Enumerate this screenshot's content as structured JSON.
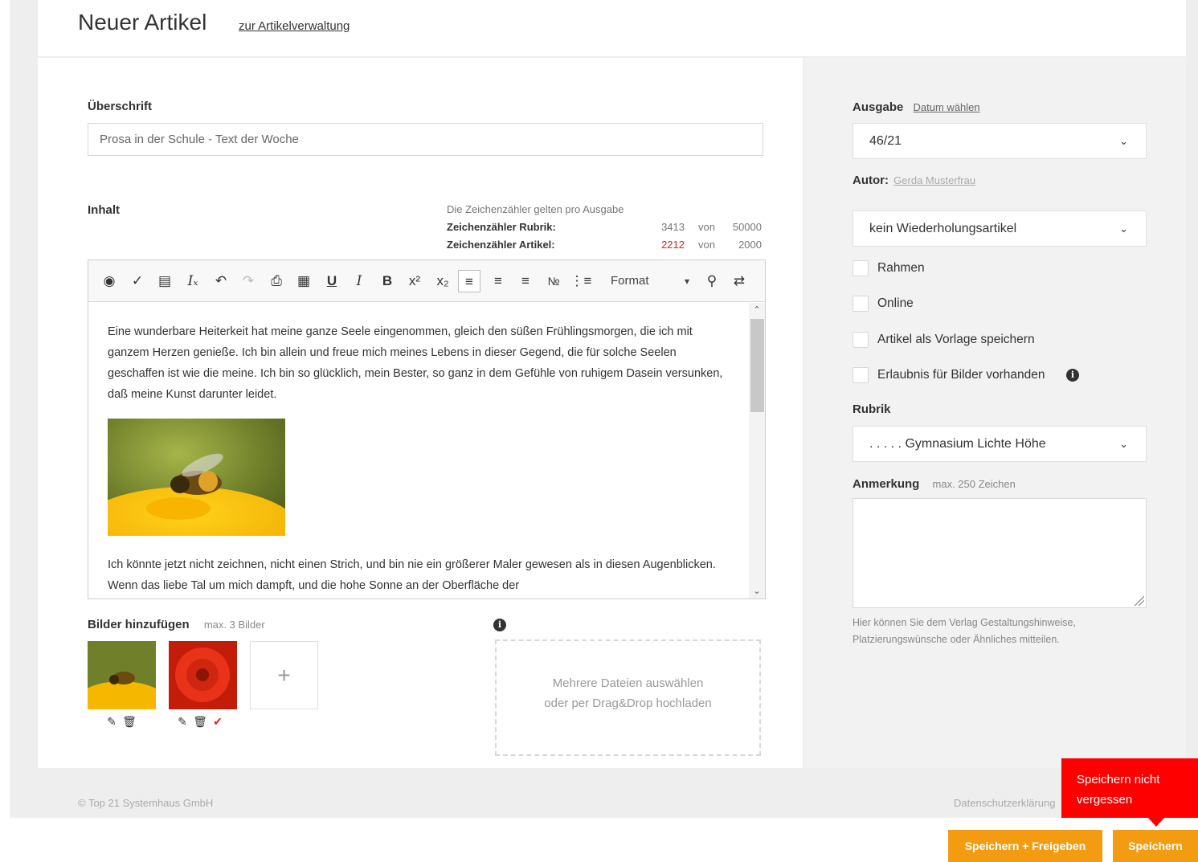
{
  "header": {
    "title": "Neuer Artikel",
    "back_link": "zur Artikelverwaltung"
  },
  "form": {
    "headline_label": "Überschrift",
    "headline_value": "Prosa in der Schule - Text der Woche",
    "content_label": "Inhalt",
    "counter_note": "Die Zeichenzähler gelten pro Ausgabe",
    "counters": [
      {
        "label": "Zeichenzähler Rubrik:",
        "value": "3413",
        "of": "von",
        "max": "50000",
        "over_limit": false
      },
      {
        "label": "Zeichenzähler Artikel:",
        "value": "2212",
        "of": "von",
        "max": "2000",
        "over_limit": true
      }
    ]
  },
  "editor": {
    "toolbar": {
      "icons": [
        "source-icon",
        "spellcheck-icon",
        "paste-text-icon",
        "remove-format-icon",
        "undo-icon",
        "redo-icon",
        "paste-icon",
        "table-icon",
        "underline-icon",
        "italic-icon",
        "bold-icon",
        "superscript-icon",
        "subscript-icon",
        "align-left-icon",
        "align-center-icon",
        "align-right-icon",
        "numbered-list-icon",
        "bulleted-list-icon",
        "search-icon",
        "replace-icon"
      ],
      "format_label": "Format",
      "active_accent": "#bbbbbb"
    },
    "paragraph_1": "Eine wunderbare Heiterkeit hat meine ganze Seele eingenommen, gleich den süßen Frühlingsmorgen, die ich mit ganzem Herzen genieße. Ich bin allein und freue mich meines Lebens in dieser Gegend, die für solche Seelen geschaffen ist wie die meine. Ich bin so glücklich, mein Bester, so ganz in dem Gefühle von ruhigem Dasein versunken, daß meine Kunst darunter leidet.",
    "paragraph_2": "Ich könnte jetzt nicht zeichnen, nicht einen Strich, und bin nie ein größerer Maler gewesen als in diesen Augenblicken. Wenn das liebe Tal um mich dampft, und die hohe Sonne an der Oberfläche der"
  },
  "images": {
    "label": "Bilder hinzufügen",
    "hint": "max. 3 Bilder",
    "add_symbol": "+",
    "dropzone_line1": "Mehrere Dateien auswählen",
    "dropzone_line2": "oder per Drag&Drop hochladen"
  },
  "sidebar": {
    "edition_label": "Ausgabe",
    "edition_link": "Datum wählen",
    "edition_value": "46/21",
    "author_label": "Autor:",
    "author_value": "Gerda Musterfrau",
    "repeat_value": "kein Wiederholungsartikel",
    "checkboxes": [
      {
        "label": "Rahmen",
        "checked": false
      },
      {
        "label": "Online",
        "checked": false
      },
      {
        "label": "Artikel als Vorlage speichern",
        "checked": false
      },
      {
        "label": "Erlaubnis für Bilder vorhanden",
        "checked": false
      }
    ],
    "rubric_label": "Rubrik",
    "rubric_value": ". . . . . Gymnasium Lichte Höhe",
    "note_label": "Anmerkung",
    "note_hint": "max. 250 Zeichen",
    "note_value": "",
    "help_text": "Hier können Sie dem Verlag Gestaltungshinweise, Platzierungswünsche oder Ähnliches mitteilen."
  },
  "footer": {
    "copyright": "© Top 21 Systemhaus GmbH",
    "privacy": "Datenschutzerklärung"
  },
  "tooltip": {
    "text_line1": "Speichern nicht",
    "text_line2": "vergessen",
    "color": "#ff0000"
  },
  "actions": {
    "save_publish": "Speichern + Freigeben",
    "save": "Speichern",
    "color": "#f39c12"
  }
}
